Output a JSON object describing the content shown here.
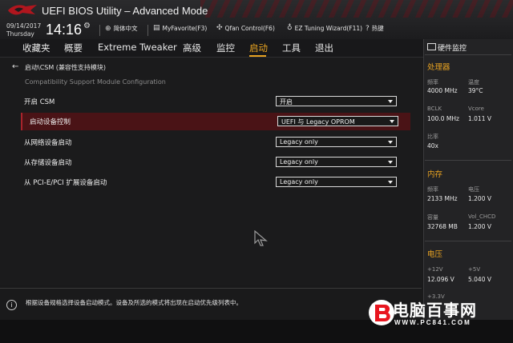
{
  "header": {
    "title": "UEFI BIOS Utility – Advanced Mode",
    "date": "09/14/2017",
    "day": "Thursday",
    "time": "14:16",
    "buttons": [
      {
        "icon": "globe-icon",
        "label": "简体中文"
      },
      {
        "icon": "favorite-icon",
        "label": "MyFavorite(F3)"
      },
      {
        "icon": "fan-icon",
        "label": "Qfan Control(F6)"
      },
      {
        "icon": "tuning-icon",
        "label": "EZ Tuning Wizard(F11)"
      },
      {
        "icon": "hotkey-icon",
        "label": "热键"
      }
    ]
  },
  "menu": {
    "tabs": [
      "收藏夹",
      "概要",
      "Extreme Tweaker",
      "高级",
      "监控",
      "启动",
      "工具",
      "退出"
    ],
    "active": "启动"
  },
  "main": {
    "breadcrumb": "启动\\CSM (兼容性支持模块)",
    "subtitle": "Compatibility Support Module Configuration",
    "rows": [
      {
        "label": "开启 CSM",
        "value": "开启"
      },
      {
        "label": "启动设备控制",
        "value": "UEFI 与 Legacy OPROM"
      },
      {
        "label": "从网络设备启动",
        "value": "Legacy only"
      },
      {
        "label": "从存储设备启动",
        "value": "Legacy only"
      },
      {
        "label": "从 PCI-E/PCI 扩展设备启动",
        "value": "Legacy only"
      }
    ]
  },
  "help": {
    "text": "根据设备规格选择设备启动模式。设备及所选的模式将出现在启动优先级列表中。"
  },
  "hw_monitor": {
    "title": "硬件监控",
    "cpu": {
      "section": "处理器",
      "freq_label": "频率",
      "freq": "4000 MHz",
      "temp_label": "温度",
      "temp": "39°C",
      "bclk_label": "BCLK",
      "bclk": "100.0 MHz",
      "vcore_label": "Vcore",
      "vcore": "1.011 V",
      "ratio_label": "比率",
      "ratio": "40x"
    },
    "memory": {
      "section": "内存",
      "freq_label": "频率",
      "freq": "2133 MHz",
      "volt_label": "电压",
      "volt": "1.200 V",
      "cap_label": "容量",
      "cap": "32768 MB",
      "vchcd_label": "Vol_CHCD",
      "vchcd": "1.200 V"
    },
    "voltage": {
      "section": "电压",
      "v12_label": "+12V",
      "v12": "12.096 V",
      "v5_label": "+5V",
      "v5": "5.040 V",
      "v33_label": "+3.3V"
    }
  },
  "watermark": {
    "text": "电脑百事网",
    "url": "WWW.PC841.COM"
  },
  "colors": {
    "accent": "#e8a321",
    "selected_row": "#4a1316",
    "selected_border": "#a9242c"
  }
}
